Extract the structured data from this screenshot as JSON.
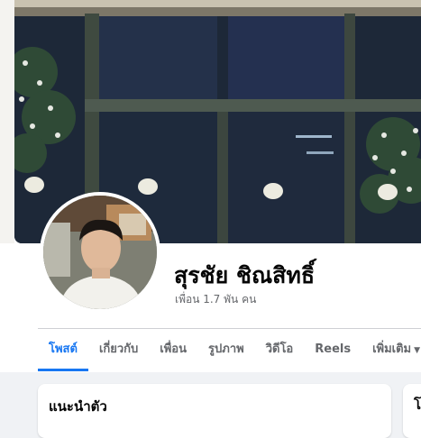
{
  "profile": {
    "name": "สุรชัย ชิณสิทธิ์",
    "friends": "เพื่อน 1.7 พัน คน"
  },
  "tabs": [
    {
      "label": "โพสต์",
      "active": true
    },
    {
      "label": "เกี่ยวกับ",
      "active": false
    },
    {
      "label": "เพื่อน",
      "active": false
    },
    {
      "label": "รูปภาพ",
      "active": false
    },
    {
      "label": "วิดีโอ",
      "active": false
    },
    {
      "label": "Reels",
      "active": false
    },
    {
      "label": "เพิ่มเติม",
      "active": false
    }
  ],
  "intro_card": {
    "title": "แนะนำตัว"
  },
  "side_card": {
    "title": "โ"
  },
  "icons": {
    "more_caret": "caret-down-icon"
  },
  "colors": {
    "accent": "#1877f2",
    "text": "#050505",
    "secondary_text": "#65676b",
    "background": "#f0f2f5"
  }
}
